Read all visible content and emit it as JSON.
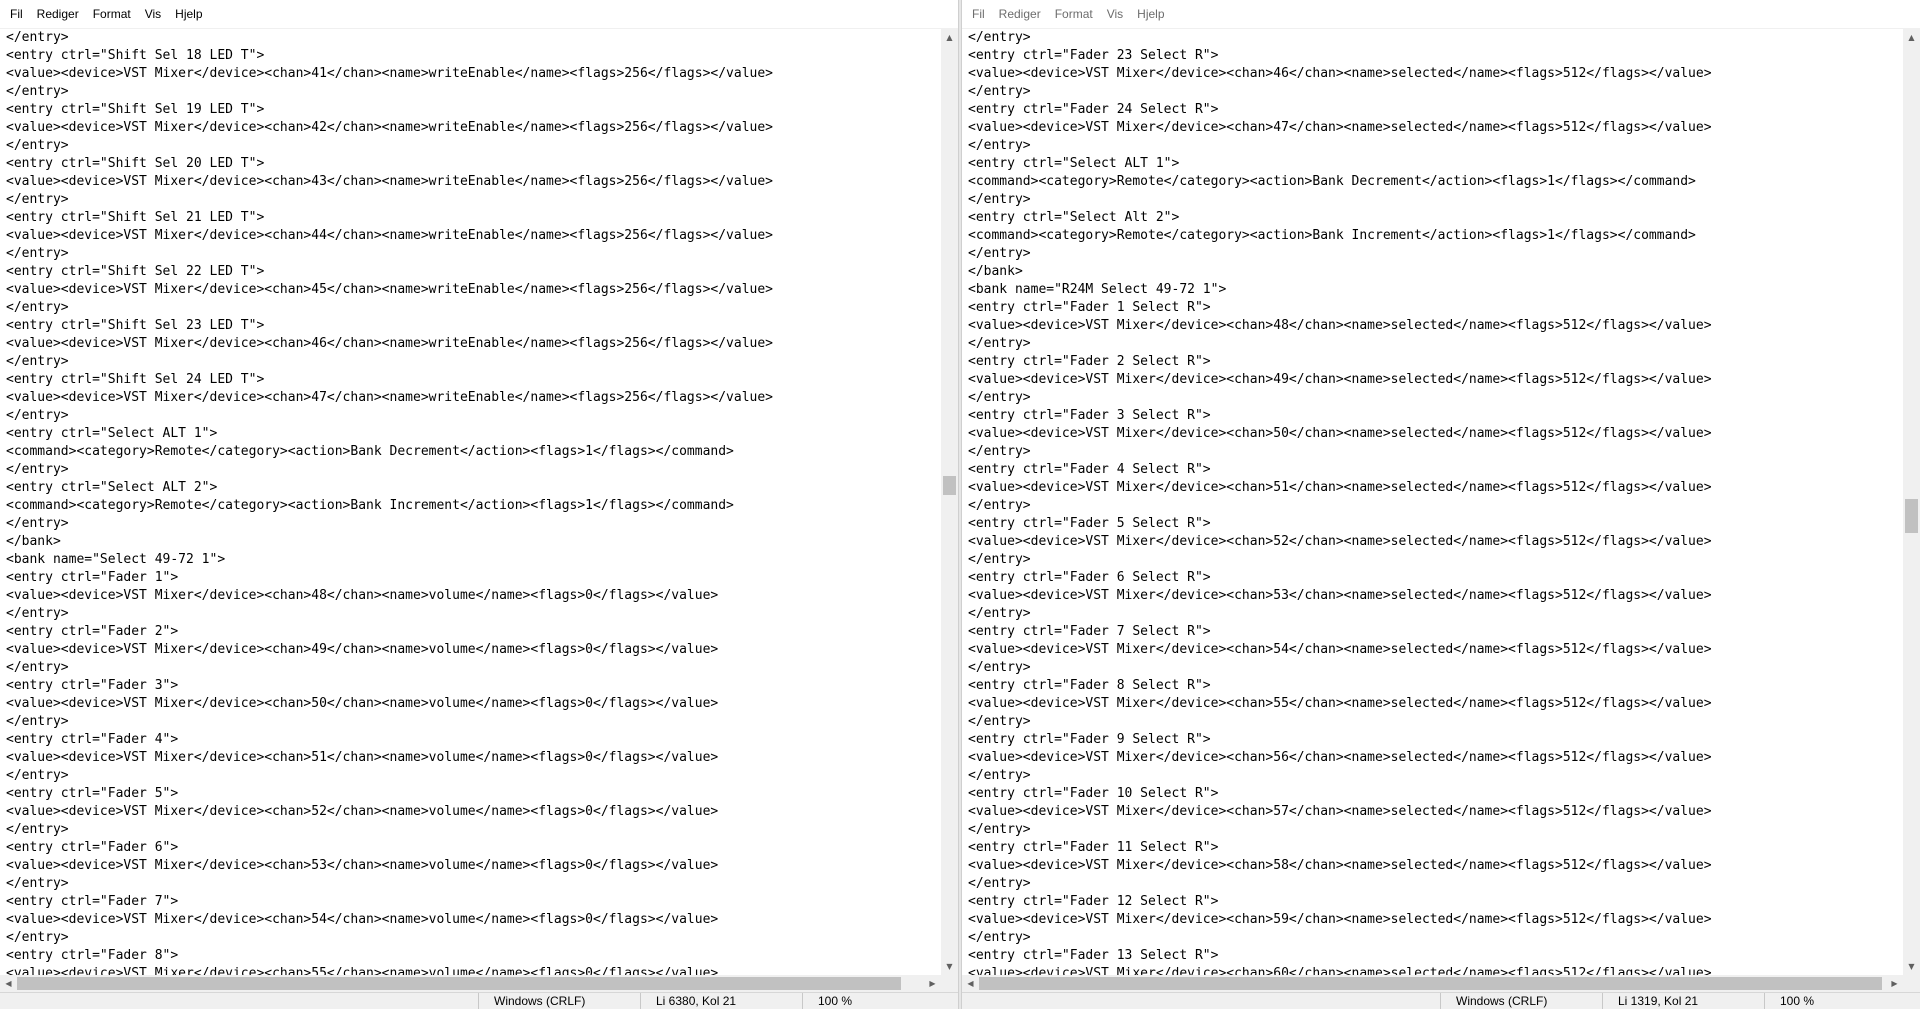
{
  "left": {
    "menu": [
      "Fil",
      "Rediger",
      "Format",
      "Vis",
      "Hjelp"
    ],
    "lines": [
      "</entry>",
      "<entry ctrl=\"Shift Sel 18 LED T\">",
      "<value><device>VST Mixer</device><chan>41</chan><name>writeEnable</name><flags>256</flags></value>",
      "</entry>",
      "<entry ctrl=\"Shift Sel 19 LED T\">",
      "<value><device>VST Mixer</device><chan>42</chan><name>writeEnable</name><flags>256</flags></value>",
      "</entry>",
      "<entry ctrl=\"Shift Sel 20 LED T\">",
      "<value><device>VST Mixer</device><chan>43</chan><name>writeEnable</name><flags>256</flags></value>",
      "</entry>",
      "<entry ctrl=\"Shift Sel 21 LED T\">",
      "<value><device>VST Mixer</device><chan>44</chan><name>writeEnable</name><flags>256</flags></value>",
      "</entry>",
      "<entry ctrl=\"Shift Sel 22 LED T\">",
      "<value><device>VST Mixer</device><chan>45</chan><name>writeEnable</name><flags>256</flags></value>",
      "</entry>",
      "<entry ctrl=\"Shift Sel 23 LED T\">",
      "<value><device>VST Mixer</device><chan>46</chan><name>writeEnable</name><flags>256</flags></value>",
      "</entry>",
      "<entry ctrl=\"Shift Sel 24 LED T\">",
      "<value><device>VST Mixer</device><chan>47</chan><name>writeEnable</name><flags>256</flags></value>",
      "</entry>",
      "<entry ctrl=\"Select ALT 1\">",
      "<command><category>Remote</category><action>Bank Decrement</action><flags>1</flags></command>",
      "</entry>",
      "<entry ctrl=\"Select ALT 2\">",
      "<command><category>Remote</category><action>Bank Increment</action><flags>1</flags></command>",
      "</entry>",
      "</bank>",
      "<bank name=\"Select 49-72 1\">",
      "<entry ctrl=\"Fader 1\">",
      "<value><device>VST Mixer</device><chan>48</chan><name>volume</name><flags>0</flags></value>",
      "</entry>",
      "<entry ctrl=\"Fader 2\">",
      "<value><device>VST Mixer</device><chan>49</chan><name>volume</name><flags>0</flags></value>",
      "</entry>",
      "<entry ctrl=\"Fader 3\">",
      "<value><device>VST Mixer</device><chan>50</chan><name>volume</name><flags>0</flags></value>",
      "</entry>",
      "<entry ctrl=\"Fader 4\">",
      "<value><device>VST Mixer</device><chan>51</chan><name>volume</name><flags>0</flags></value>",
      "</entry>",
      "<entry ctrl=\"Fader 5\">",
      "<value><device>VST Mixer</device><chan>52</chan><name>volume</name><flags>0</flags></value>",
      "</entry>",
      "<entry ctrl=\"Fader 6\">",
      "<value><device>VST Mixer</device><chan>53</chan><name>volume</name><flags>0</flags></value>",
      "</entry>",
      "<entry ctrl=\"Fader 7\">",
      "<value><device>VST Mixer</device><chan>54</chan><name>volume</name><flags>0</flags></value>",
      "</entry>",
      "<entry ctrl=\"Fader 8\">",
      "<value><device>VST Mixer</device><chan>55</chan><name>volume</name><flags>0</flags></value>"
    ],
    "status": {
      "encoding": "Windows (CRLF)",
      "position": "Li 6380, Kol 21",
      "zoom": "100 %"
    }
  },
  "right": {
    "menu": [
      "Fil",
      "Rediger",
      "Format",
      "Vis",
      "Hjelp"
    ],
    "lines": [
      "</entry>",
      "<entry ctrl=\"Fader 23 Select R\">",
      "<value><device>VST Mixer</device><chan>46</chan><name>selected</name><flags>512</flags></value>",
      "</entry>",
      "<entry ctrl=\"Fader 24 Select R\">",
      "<value><device>VST Mixer</device><chan>47</chan><name>selected</name><flags>512</flags></value>",
      "</entry>",
      "<entry ctrl=\"Select ALT 1\">",
      "<command><category>Remote</category><action>Bank Decrement</action><flags>1</flags></command>",
      "</entry>",
      "<entry ctrl=\"Select Alt 2\">",
      "<command><category>Remote</category><action>Bank Increment</action><flags>1</flags></command>",
      "</entry>",
      "</bank>",
      "<bank name=\"R24M Select 49-72 1\">",
      "<entry ctrl=\"Fader 1 Select R\">",
      "<value><device>VST Mixer</device><chan>48</chan><name>selected</name><flags>512</flags></value>",
      "</entry>",
      "<entry ctrl=\"Fader 2 Select R\">",
      "<value><device>VST Mixer</device><chan>49</chan><name>selected</name><flags>512</flags></value>",
      "</entry>",
      "<entry ctrl=\"Fader 3 Select R\">",
      "<value><device>VST Mixer</device><chan>50</chan><name>selected</name><flags>512</flags></value>",
      "</entry>",
      "<entry ctrl=\"Fader 4 Select R\">",
      "<value><device>VST Mixer</device><chan>51</chan><name>selected</name><flags>512</flags></value>",
      "</entry>",
      "<entry ctrl=\"Fader 5 Select R\">",
      "<value><device>VST Mixer</device><chan>52</chan><name>selected</name><flags>512</flags></value>",
      "</entry>",
      "<entry ctrl=\"Fader 6 Select R\">",
      "<value><device>VST Mixer</device><chan>53</chan><name>selected</name><flags>512</flags></value>",
      "</entry>",
      "<entry ctrl=\"Fader 7 Select R\">",
      "<value><device>VST Mixer</device><chan>54</chan><name>selected</name><flags>512</flags></value>",
      "</entry>",
      "<entry ctrl=\"Fader 8 Select R\">",
      "<value><device>VST Mixer</device><chan>55</chan><name>selected</name><flags>512</flags></value>",
      "</entry>",
      "<entry ctrl=\"Fader 9 Select R\">",
      "<value><device>VST Mixer</device><chan>56</chan><name>selected</name><flags>512</flags></value>",
      "</entry>",
      "<entry ctrl=\"Fader 10 Select R\">",
      "<value><device>VST Mixer</device><chan>57</chan><name>selected</name><flags>512</flags></value>",
      "</entry>",
      "<entry ctrl=\"Fader 11 Select R\">",
      "<value><device>VST Mixer</device><chan>58</chan><name>selected</name><flags>512</flags></value>",
      "</entry>",
      "<entry ctrl=\"Fader 12 Select R\">",
      "<value><device>VST Mixer</device><chan>59</chan><name>selected</name><flags>512</flags></value>",
      "</entry>",
      "<entry ctrl=\"Fader 13 Select R\">",
      "<value><device>VST Mixer</device><chan>60</chan><name>selected</name><flags>512</flags></value>"
    ],
    "status": {
      "encoding": "Windows (CRLF)",
      "position": "Li 1319, Kol 21",
      "zoom": "100 %"
    }
  }
}
